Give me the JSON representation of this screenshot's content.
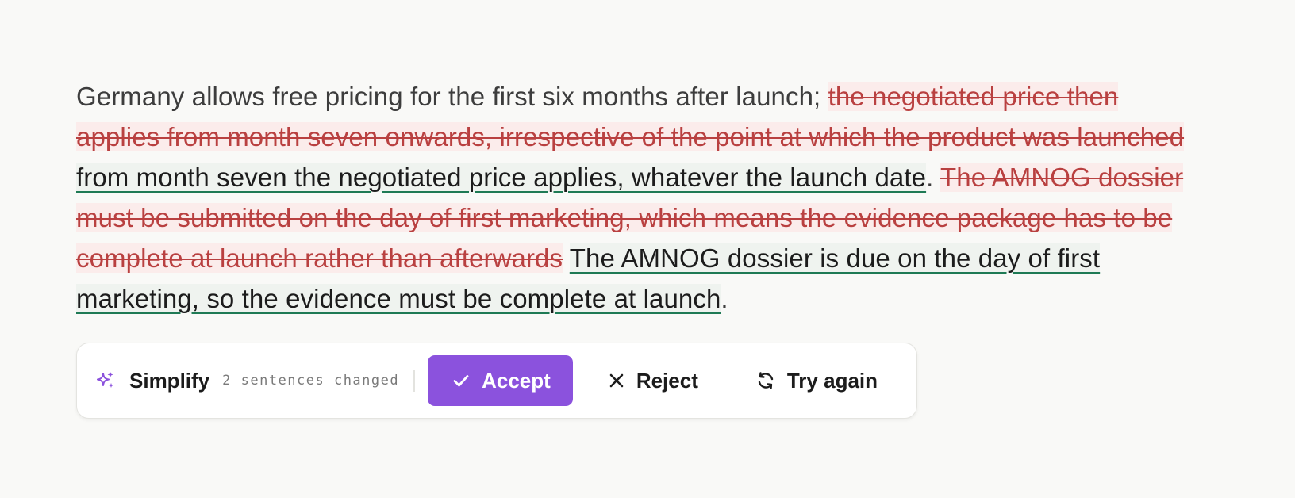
{
  "document": {
    "seg1": "Germany allows free pricing for the first six months after launch; ",
    "del1": "the negotiated price then applies from month seven onwards, irrespective of the point at which the product was launched",
    "ins1": "from month seven the negotiated price applies, whatever the launch date",
    "seg2": ". ",
    "del2": "The AMNOG dossier must be submitted on the day of first marketing, which means the evidence package has to be complete at launch rather than afterwards",
    "ins2": "The AMNOG dossier is due on the day of first marketing, so the evidence must be complete at launch",
    "seg3": "."
  },
  "toolbar": {
    "icon": "sparkle-icon",
    "title": "Simplify",
    "meta": "2 sentences changed",
    "accept_label": "Accept",
    "reject_label": "Reject",
    "try_again_label": "Try again"
  },
  "colors": {
    "accent": "#8b52dd",
    "deletion": "#b94040",
    "insertion_underline": "#1f7a55"
  }
}
